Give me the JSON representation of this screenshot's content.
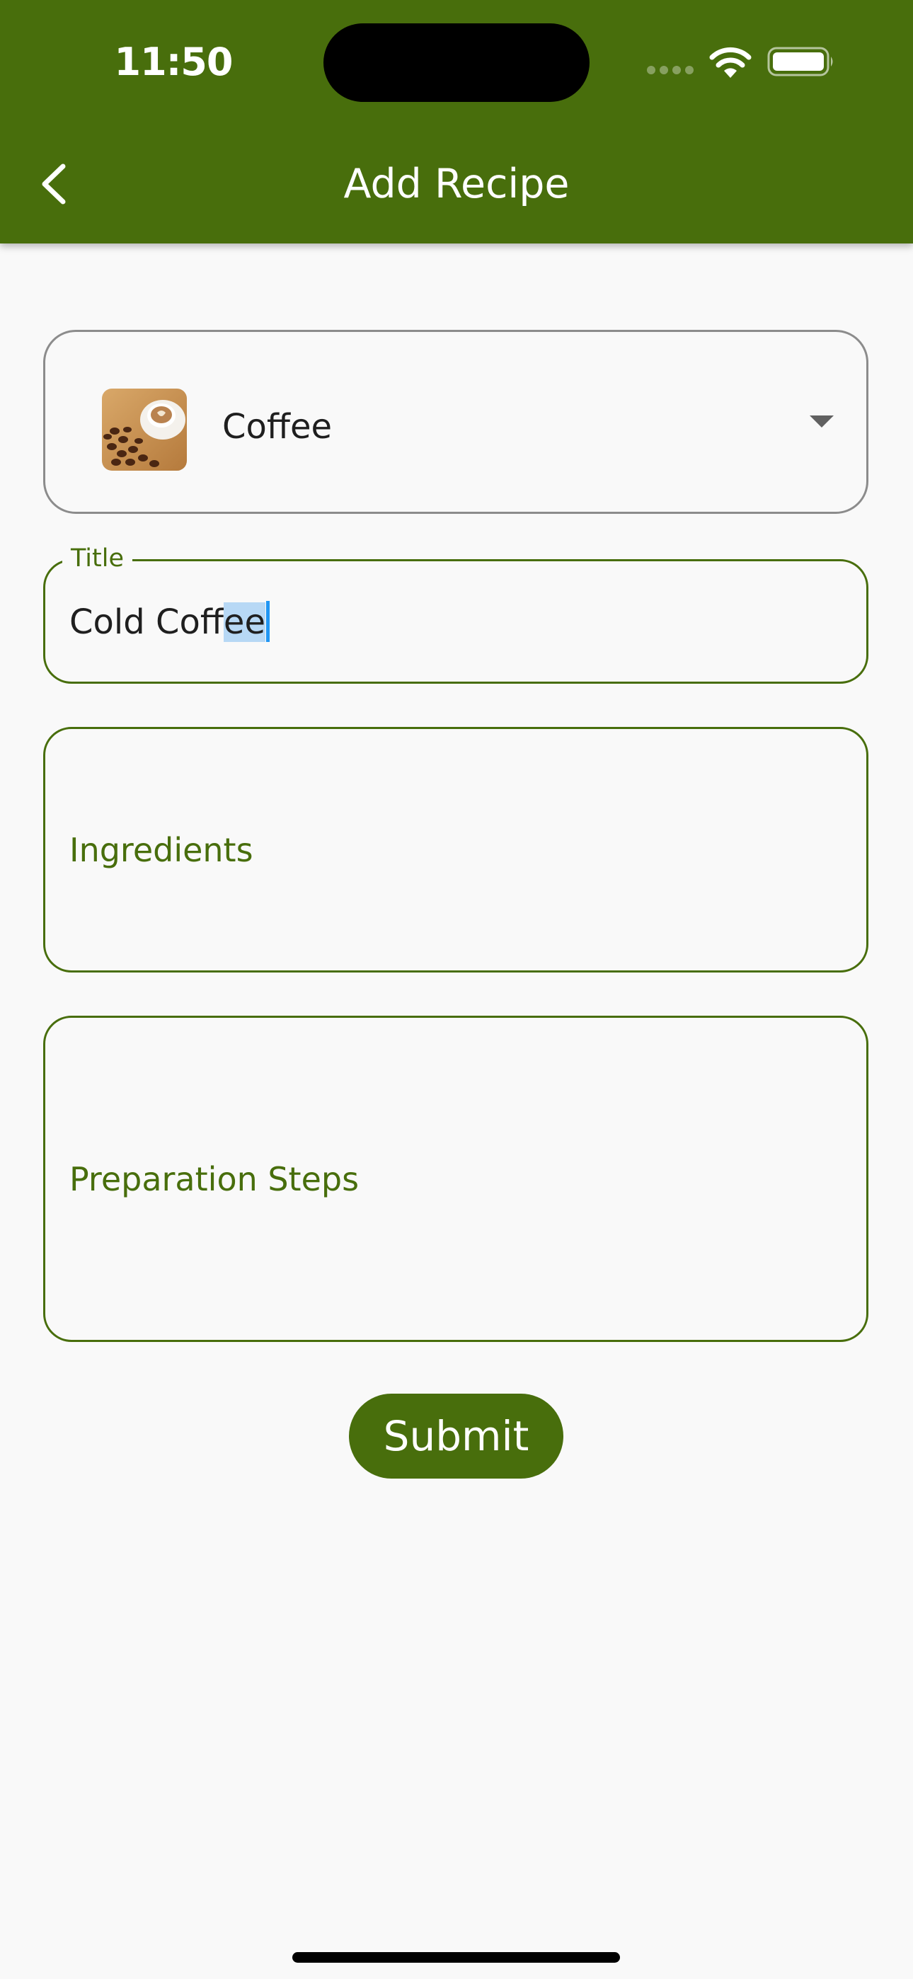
{
  "status_bar": {
    "time": "11:50"
  },
  "app_bar": {
    "title": "Add Recipe",
    "back_icon": "chevron-left-icon",
    "background_color": "#486e0c"
  },
  "form": {
    "category": {
      "selected": "Coffee",
      "thumbnail": "coffee-thumbnail",
      "arrow_icon": "dropdown-arrow-icon"
    },
    "title_field": {
      "label": "Title",
      "value_plain": "Cold Coff",
      "value_selected": "ee"
    },
    "ingredients_field": {
      "placeholder": "Ingredients"
    },
    "steps_field": {
      "placeholder": "Preparation Steps"
    },
    "submit_label": "Submit"
  },
  "colors": {
    "accent": "#486e0c",
    "background": "#f9f9f9",
    "cursor": "#2196f3"
  }
}
